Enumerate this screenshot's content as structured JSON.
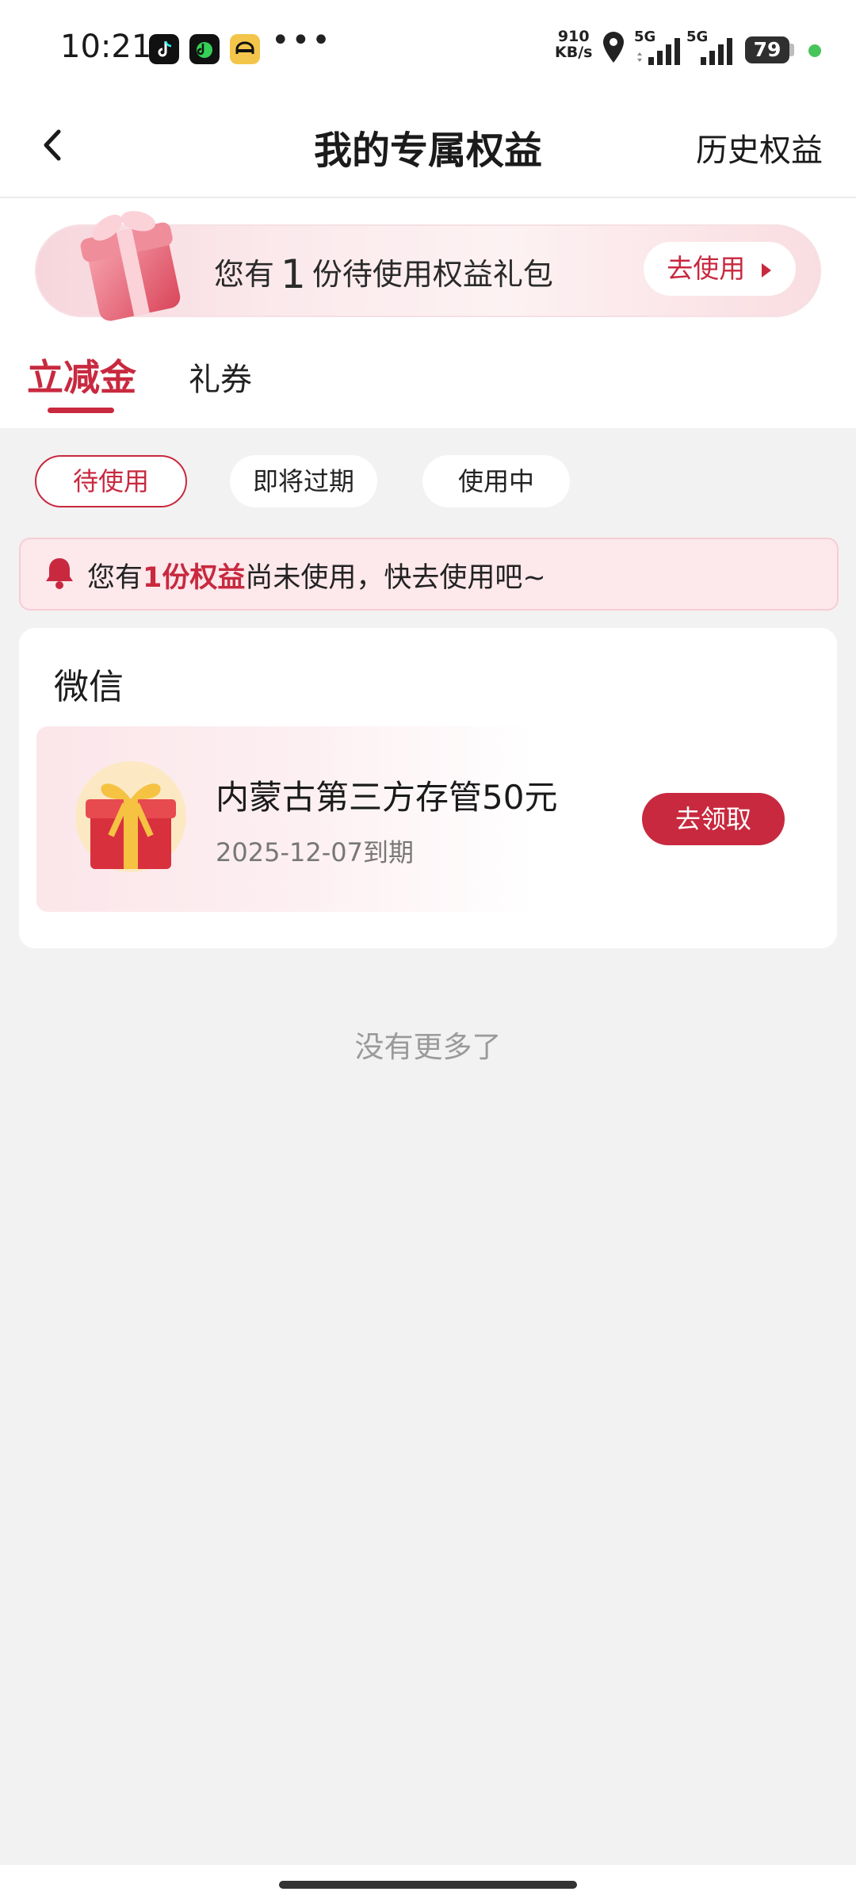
{
  "status_bar": {
    "time": "10:21",
    "speed_value": "910",
    "speed_unit": "KB/s",
    "signal1_label": "5G",
    "signal2_label": "5G",
    "battery": "79",
    "app_icons": [
      "tiktok-icon",
      "music-app-icon",
      "car-app-icon"
    ],
    "overflow": "•••"
  },
  "nav": {
    "title": "我的专属权益",
    "right_link": "历史权益",
    "back_icon": "chevron-left-icon"
  },
  "promo": {
    "prefix": "您有",
    "count": "1",
    "suffix": "份待使用权益礼包",
    "button": "去使用"
  },
  "tabs": [
    {
      "label": "立减金",
      "active": true
    },
    {
      "label": "礼券",
      "active": false
    }
  ],
  "filters": [
    {
      "label": "待使用",
      "active": true
    },
    {
      "label": "即将过期",
      "active": false
    },
    {
      "label": "使用中",
      "active": false
    }
  ],
  "notice": {
    "prefix": "您有",
    "highlight": "1份权益",
    "suffix": "尚未使用，快去使用吧~"
  },
  "card": {
    "title": "微信",
    "item": {
      "name": "内蒙古第三方存管50元",
      "expiry": "2025-12-07到期",
      "button": "去领取"
    }
  },
  "footer_text": "没有更多了",
  "colors": {
    "accent": "#c8293f",
    "background": "#f2f2f2",
    "notice_bg": "#fde8ec"
  }
}
